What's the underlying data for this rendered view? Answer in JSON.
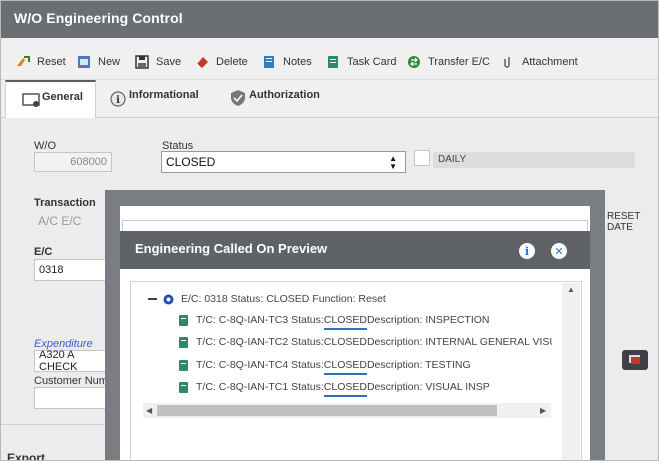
{
  "window": {
    "title": "W/O Engineering Control"
  },
  "toolbar": {
    "reset": "Reset",
    "new": "New",
    "save": "Save",
    "delete": "Delete",
    "notes": "Notes",
    "task_card": "Task Card",
    "transfer_ec": "Transfer E/C",
    "attachment": "Attachment"
  },
  "tabs": {
    "general": "General",
    "informational": "Informational",
    "authorization": "Authorization"
  },
  "form": {
    "wo_label": "W/O",
    "wo_value": "608000",
    "status_label": "Status",
    "status_value": "CLOSED",
    "daily_label": "DAILY",
    "transaction_label": "Transaction",
    "transaction_value": "A/C E/C",
    "reset_date_label": "RESET DATE",
    "ec_label": "E/C",
    "ec_value": "0318",
    "expenditure_label": "Expenditure",
    "expenditure_value": "A320 A CHECK",
    "customer_label": "Customer Numb",
    "export_label": "Export"
  },
  "dialog": {
    "title": "Engineering Called On Preview",
    "root": {
      "prefix": "E/C: 0318 Status: CLOSED Function: Reset"
    },
    "items": [
      {
        "pre": "T/C: C-8Q-IAN-TC3 Status: ",
        "status": "CLOSED",
        "post": " Description: INSPECTION"
      },
      {
        "pre": "T/C: C-8Q-IAN-TC2 Status: ",
        "status": "CLOSED",
        "post": " Description: INTERNAL GENERAL VISUAL INSP"
      },
      {
        "pre": "T/C: C-8Q-IAN-TC4 Status: ",
        "status": "CLOSED",
        "post": " Description: TESTING"
      },
      {
        "pre": "T/C: C-8Q-IAN-TC1 Status: ",
        "status": "CLOSED",
        "post": " Description: VISUAL INSP"
      }
    ]
  },
  "colors": {
    "header_bg": "#5f6368",
    "title_bg": "#6b6e72",
    "underline": "#2b72c4"
  }
}
